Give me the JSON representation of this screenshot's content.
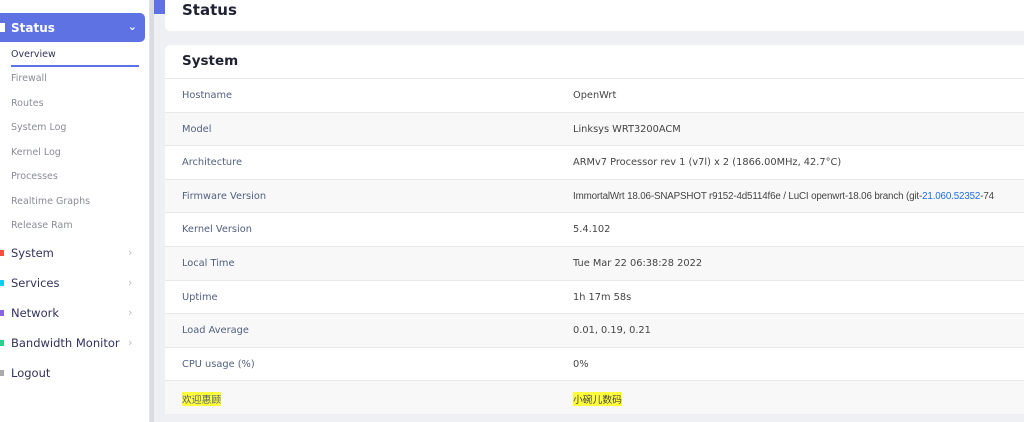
{
  "sidebar": {
    "status_label": "Status",
    "sub_items": [
      {
        "label": "Overview",
        "active": true
      },
      {
        "label": "Firewall"
      },
      {
        "label": "Routes"
      },
      {
        "label": "System Log"
      },
      {
        "label": "Kernel Log"
      },
      {
        "label": "Processes"
      },
      {
        "label": "Realtime Graphs"
      },
      {
        "label": "Release Ram"
      }
    ],
    "menu_items": [
      {
        "label": "System",
        "color": "#f5503d"
      },
      {
        "label": "Services",
        "color": "#11cdef"
      },
      {
        "label": "Network",
        "color": "#8965e0"
      },
      {
        "label": "Bandwidth Monitor",
        "color": "#2dce89"
      },
      {
        "label": "Logout",
        "color": "#aaaaaa"
      }
    ]
  },
  "page": {
    "title": "Status"
  },
  "system": {
    "title": "System",
    "rows": [
      {
        "label": "Hostname",
        "value": "OpenWrt"
      },
      {
        "label": "Model",
        "value": "Linksys WRT3200ACM"
      },
      {
        "label": "Architecture",
        "value": "ARMv7 Processor rev 1 (v7l) x 2 (1866.00MHz, 42.7°C)"
      },
      {
        "label": "Firmware Version",
        "value": "ImmortalWrt 18.06-SNAPSHOT r9152-4d5114f6e / LuCI openwrt-18.06 branch (git-",
        "link": "21.060.52352",
        "suffix": "-74"
      },
      {
        "label": "Kernel Version",
        "value": "5.4.102"
      },
      {
        "label": "Local Time",
        "value": "Tue Mar 22 06:38:28 2022"
      },
      {
        "label": "Uptime",
        "value": "1h 17m 58s"
      },
      {
        "label": "Load Average",
        "value": "0.01, 0.19, 0.21"
      },
      {
        "label": "CPU usage (%)",
        "value": "0%"
      },
      {
        "label": "欢迎惠顾",
        "value": "小碗儿数码"
      }
    ]
  },
  "colors": {
    "accent": "#5e72e4",
    "highlight": "#ffff3b"
  }
}
